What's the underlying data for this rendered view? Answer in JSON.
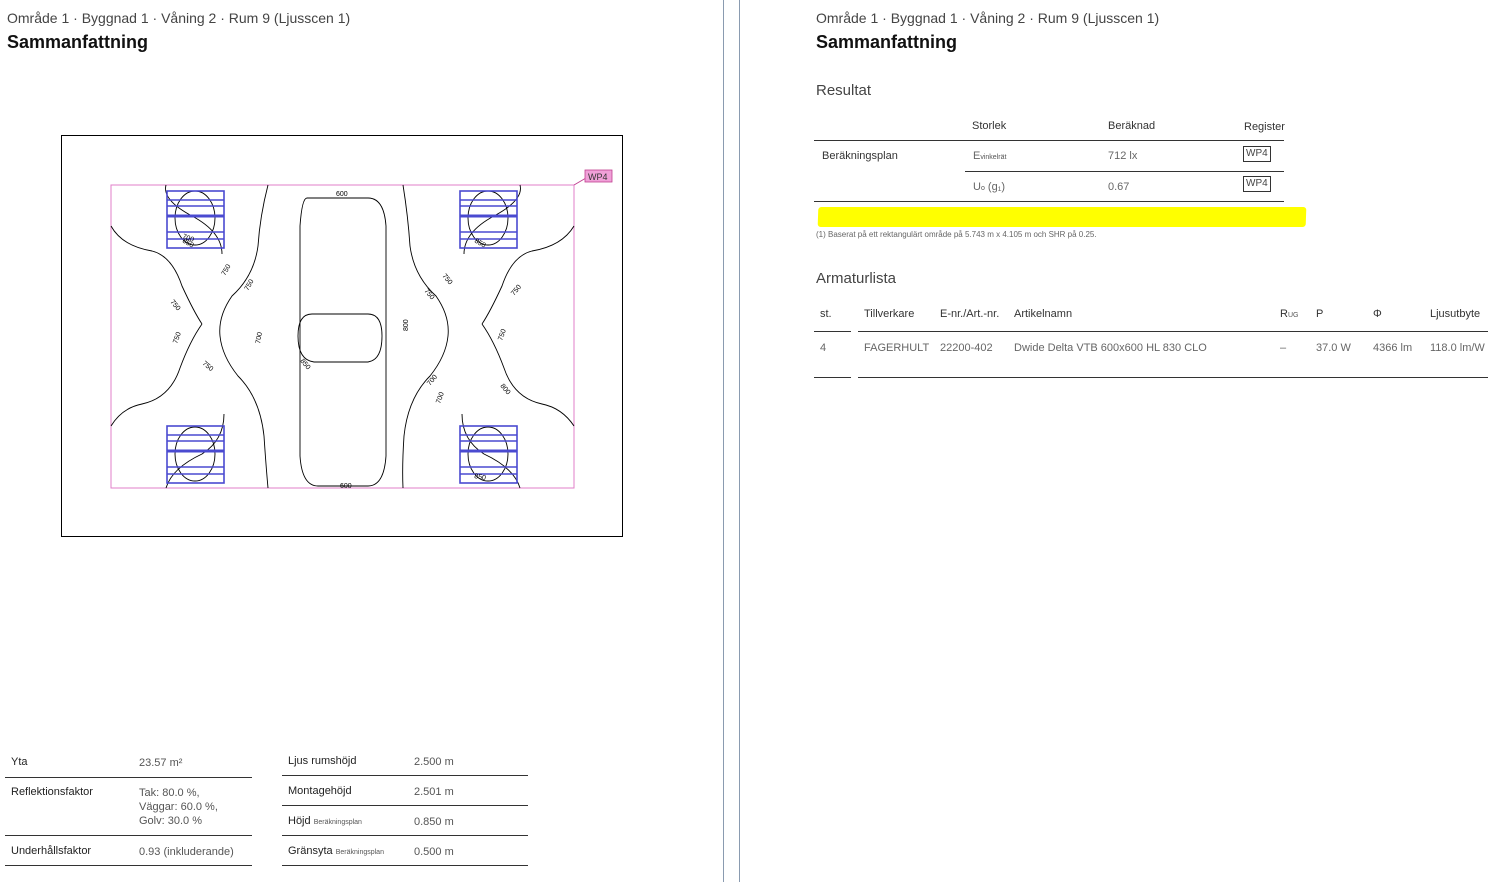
{
  "left": {
    "breadcrumb": "Område 1 · Byggnad 1 · Våning 2 · Rum 9 (Ljusscen 1)",
    "title": "Sammanfattning",
    "plan": {
      "label": "WP4",
      "contours": [
        "600",
        "750",
        "750",
        "750",
        "750",
        "750",
        "700",
        "700",
        "800",
        "850",
        "750",
        "750",
        "750",
        "750",
        "700",
        "700",
        "600",
        "800",
        "850",
        "850",
        "850"
      ]
    },
    "properties_a": [
      {
        "key": "Yta",
        "value": "23.57 m²"
      },
      {
        "key": "Reflektionsfaktor",
        "value_lines": [
          "Tak: 80.0 %,",
          "Väggar: 60.0 %,",
          "Golv: 30.0 %"
        ]
      },
      {
        "key": "Underhållsfaktor",
        "value": "0.93 (inkluderande)"
      }
    ],
    "properties_b": [
      {
        "key": "Ljus rumshöjd",
        "value": "2.500 m"
      },
      {
        "key": "Montagehöjd",
        "value": "2.501 m"
      },
      {
        "key": "Höjd",
        "sub": "Beräkningsplan",
        "value": "0.850 m"
      },
      {
        "key": "Gränsyta",
        "sub": "Beräkningsplan",
        "value": "0.500 m"
      }
    ]
  },
  "right": {
    "breadcrumb": "Område 1 · Byggnad 1 · Våning 2 · Rum 9 (Ljusscen 1)",
    "title": "Sammanfattning",
    "results": {
      "heading": "Resultat",
      "col_size": "Storlek",
      "col_calc": "Beräknad",
      "col_register": "Register",
      "row_label": "Beräkningsplan",
      "rows": [
        {
          "size": "E",
          "size_sub": "vinkelrät",
          "calc": "712 lx",
          "register": "WP4"
        },
        {
          "size": "U",
          "size_sub": "o",
          "size_suffix": " (g₁)",
          "calc": "0.67",
          "register": "WP4"
        }
      ],
      "footnote": "(1) Baserat på ett rektangulärt område på 5.743 m x 4.105 m och SHR på 0.25."
    },
    "luminaires": {
      "heading": "Armaturlista",
      "headers": {
        "count": "st.",
        "manufacturer": "Tillverkare",
        "article_no": "E-nr./Art.-nr.",
        "article_name": "Artikelnamn",
        "rug": "R",
        "rug_sub": "UG",
        "power": "P",
        "flux": "Φ",
        "efficacy": "Ljusutbyte"
      },
      "rows": [
        {
          "count": "4",
          "manufacturer": "FAGERHULT",
          "article_no": "22200-402",
          "article_name": "Dwide Delta VTB 600x600 HL 830 CLO",
          "rug": "–",
          "power": "37.0 W",
          "flux": "4366 lm",
          "efficacy": "118.0 lm/W"
        }
      ]
    }
  },
  "colors": {
    "luminaire": "#4a4ad0",
    "calc_area": "#e07fc8",
    "label_bg": "#f0a0d8",
    "highlight": "#ffff00"
  }
}
